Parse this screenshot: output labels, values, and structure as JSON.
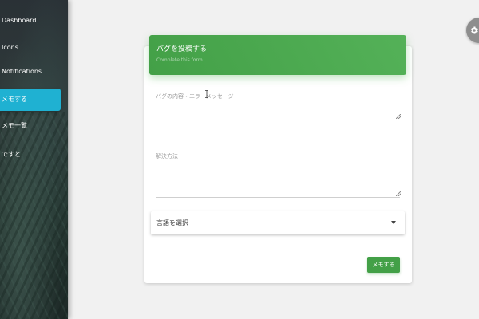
{
  "sidebar": {
    "items": [
      {
        "label": "Dashboard",
        "active": false
      },
      {
        "label": "Icons",
        "active": false
      },
      {
        "label": "Notifications",
        "active": false
      },
      {
        "label": "メモする",
        "active": true
      },
      {
        "label": "メモ一覧",
        "active": false
      },
      {
        "label": "ですと",
        "active": false
      }
    ]
  },
  "fab": {
    "icon": "gear-icon"
  },
  "form": {
    "title": "バグを投稿する",
    "subtitle": "Complete this form",
    "error_placeholder": "バグの内容・エラーメッセージ",
    "solution_placeholder": "解決方法",
    "language_select": "言語を選択",
    "submit_label": "メモする"
  },
  "colors": {
    "header_green": "#43a047",
    "active_nav": "#1fb1d2",
    "button_green": "#43a047"
  }
}
